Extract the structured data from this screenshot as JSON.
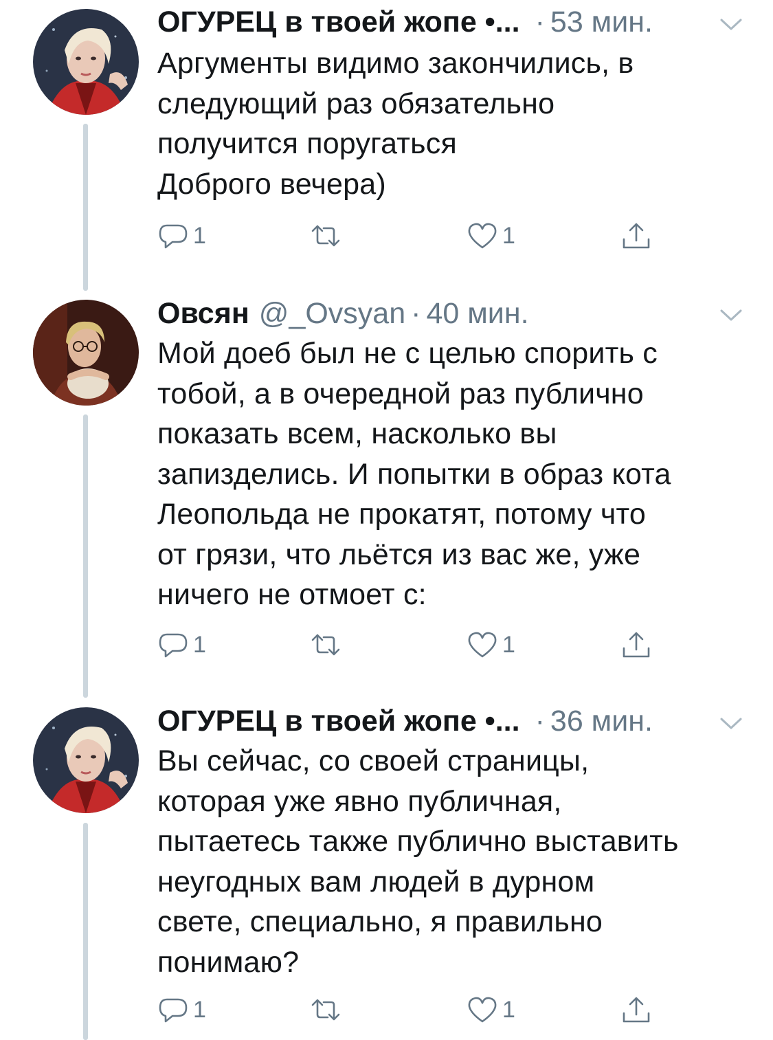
{
  "tweets": [
    {
      "name": "ОГУРЕЦ в твоей жопе •...",
      "handle": "",
      "dot": "·",
      "time": "53 мин.",
      "text": "Аргументы видимо закончились, в\nследующий раз обязательно\nполучится поругаться\nДоброго вечера)",
      "reply_count": "1",
      "retweet_count": "",
      "like_count": "1"
    },
    {
      "name": "Овсян",
      "handle": "@_Ovsyan",
      "dot": "·",
      "time": "40 мин.",
      "text": "Мой доеб был не с целью спорить с\nтобой, а в очередной раз публично\nпоказать всем, насколько вы\nзапизделись. И попытки в образ кота\nЛеопольда не прокатят, потому что\nот грязи, что льётся из вас же, уже\nничего не отмоет с:",
      "reply_count": "1",
      "retweet_count": "",
      "like_count": "1"
    },
    {
      "name": "ОГУРЕЦ в твоей жопе •...",
      "handle": "",
      "dot": "·",
      "time": "36 мин.",
      "text": "Вы сейчас, со своей страницы,\nкоторая уже явно публичная,\nпытаетесь также публично выставить\nнеугодных вам людей в дурном\nсвете, специально, я правильно\nпонимаю?",
      "reply_count": "1",
      "retweet_count": "",
      "like_count": "1"
    }
  ],
  "icons": {
    "reply": "reply-icon",
    "retweet": "retweet-icon",
    "like": "heart-icon",
    "share": "share-icon",
    "menu": "chevron-down-icon"
  },
  "colors": {
    "text": "#14171a",
    "secondary": "#657786",
    "thread_line": "#ccd6dd"
  }
}
